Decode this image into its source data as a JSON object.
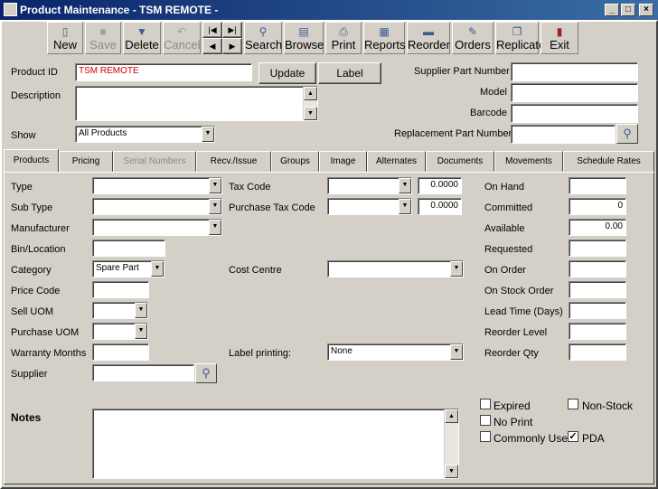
{
  "window": {
    "title": "Product Maintenance - TSM REMOTE -"
  },
  "toolbar": {
    "new": "New",
    "save": "Save",
    "delete": "Delete",
    "cancel": "Cancel",
    "search": "Search",
    "browse": "Browse",
    "print": "Print",
    "reports": "Reports",
    "reorder": "Reorder",
    "orders": "Orders",
    "replicate": "Replicate",
    "exit": "Exit"
  },
  "header": {
    "product_id_label": "Product ID",
    "product_id_value": "TSM REMOTE",
    "description_label": "Description",
    "description_value": "",
    "show_label": "Show",
    "show_value": "All Products",
    "update_button": "Update",
    "label_button": "Label",
    "supplier_part_label": "Supplier Part Number",
    "model_label": "Model",
    "barcode_label": "Barcode",
    "replacement_part_label": "Replacement Part Number",
    "product_id_color": "#cc0000"
  },
  "tabs": [
    "Products",
    "Pricing",
    "Serial Numbers",
    "Recv./Issue",
    "Groups",
    "Image",
    "Alternates",
    "Documents",
    "Movements",
    "Schedule Rates"
  ],
  "left": {
    "type": "Type",
    "sub_type": "Sub Type",
    "manufacturer": "Manufacturer",
    "bin_location": "Bin/Location",
    "category": "Category",
    "category_value": "Spare Part",
    "price_code": "Price Code",
    "sell_uom": "Sell UOM",
    "purchase_uom": "Purchase UOM",
    "warranty_months": "Warranty Months",
    "supplier": "Supplier"
  },
  "middle": {
    "tax_code": "Tax Code",
    "tax_code_value": "0.0000",
    "purchase_tax_code": "Purchase Tax Code",
    "purchase_tax_value": "0.0000",
    "cost_centre": "Cost Centre",
    "label_printing": "Label printing:",
    "label_printing_value": "None"
  },
  "stock": {
    "on_hand": "On Hand",
    "on_hand_value": "",
    "committed": "Committed",
    "committed_value": "0",
    "available": "Available",
    "available_value": "0.00",
    "requested": "Requested",
    "on_order": "On Order",
    "on_stock_order": "On Stock Order",
    "lead_time": "Lead Time (Days)",
    "reorder_level": "Reorder Level",
    "reorder_qty": "Reorder Qty"
  },
  "notes": {
    "label": "Notes"
  },
  "checks": {
    "expired": "Expired",
    "non_stock": "Non-Stock",
    "no_print": "No Print",
    "commonly_used": "Commonly Used",
    "pda": "PDA",
    "pda_checked": true
  }
}
